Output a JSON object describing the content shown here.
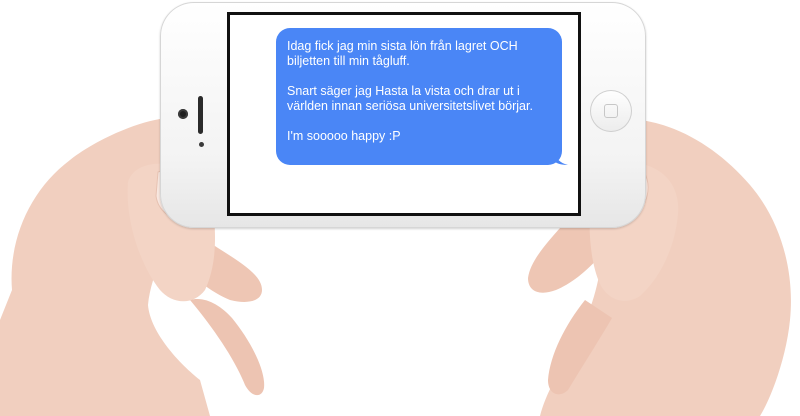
{
  "message": {
    "paragraphs": [
      "Idag fick jag min sista lön från lagret OCH biljetten till min tågluff.",
      "Snart säger jag Hasta la vista och drar ut i världen innan seriösa universitetslivet börjar.",
      "I'm sooooo happy :P"
    ],
    "bubble_color": "#4a86f6",
    "text_color": "#ffffff"
  },
  "phone": {
    "color": "#ffffff",
    "orientation": "landscape"
  },
  "icons": {
    "home_button": "home-button-icon",
    "speaker": "speaker-icon",
    "camera": "camera-icon"
  }
}
